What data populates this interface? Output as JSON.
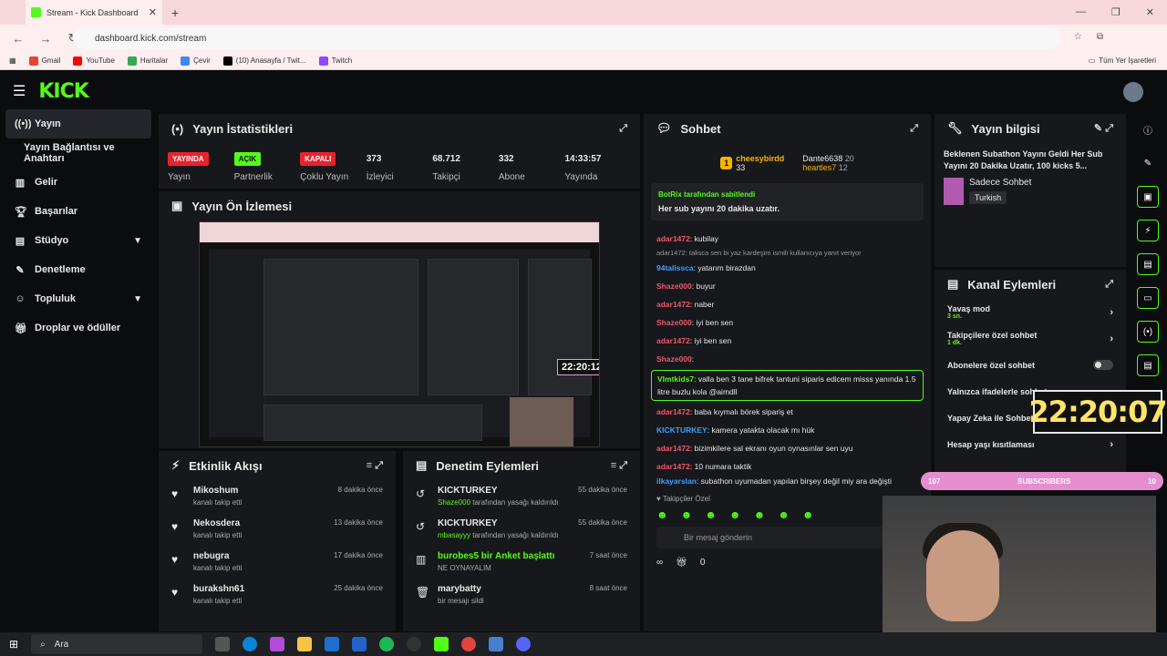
{
  "browser": {
    "tab_title": "Stream - Kick Dashboard",
    "url": "dashboard.kick.com/stream",
    "bookmarks": [
      "Gmail",
      "YouTube",
      "Haritalar",
      "Çevir",
      "(10) Anasayfa / Twit...",
      "Twitch"
    ],
    "bookmarks_right": "Tüm Yer İşaretleri"
  },
  "header": {
    "logo": "KICK"
  },
  "sidebar": {
    "items": [
      {
        "label": "Yayın"
      },
      {
        "label": "Yayın Bağlantısı ve Anahtarı"
      },
      {
        "label": "Gelir"
      },
      {
        "label": "Başarılar"
      },
      {
        "label": "Stüdyo"
      },
      {
        "label": "Denetleme"
      },
      {
        "label": "Topluluk"
      },
      {
        "label": "Droplar ve ödüller"
      }
    ]
  },
  "stats": {
    "title": "Yayın İstatistikleri",
    "items": [
      {
        "value": "YAYINDA",
        "label": "Yayın",
        "color": "#e8232e"
      },
      {
        "value": "AÇIK",
        "label": "Partnerlik",
        "color": "#53fc18"
      },
      {
        "value": "KAPALI",
        "label": "Çoklu Yayın",
        "color": "#e8232e"
      },
      {
        "value": "373",
        "label": "İzleyici"
      },
      {
        "value": "68.712",
        "label": "Takipçi"
      },
      {
        "value": "332",
        "label": "Abone"
      },
      {
        "value": "14:33:57",
        "label": "Yayında"
      }
    ]
  },
  "preview": {
    "title": "Yayın Ön İzlemesi",
    "timer": "22:20:12"
  },
  "activity": {
    "title": "Etkinlik Akışı",
    "items": [
      {
        "name": "Mikoshum",
        "sub": "kanalı takip etti",
        "time": "8 dakika önce"
      },
      {
        "name": "Nekosdera",
        "sub": "kanalı takip etti",
        "time": "13 dakika önce"
      },
      {
        "name": "nebugra",
        "sub": "kanalı takip etti",
        "time": "17 dakika önce"
      },
      {
        "name": "burakshn61",
        "sub": "kanalı takip etti",
        "time": "25 dakika önce"
      }
    ]
  },
  "moderation": {
    "title": "Denetim Eylemleri",
    "items": [
      {
        "name": "KICKTURKEY",
        "who": "Shaze000",
        "sub": " tarafından yasağı kaldırıldı",
        "time": "55 dakika önce"
      },
      {
        "name": "KICKTURKEY",
        "who": "mbasayyy",
        "sub": " tarafından yasağı kaldırıldı",
        "time": "55 dakika önce"
      },
      {
        "name": "burobes5 bir Anket başlattı",
        "who": "",
        "sub": "NE OYNAYALIM",
        "time": "7 saat önce"
      },
      {
        "name": "marybatty",
        "who": "",
        "sub": "bir mesajı sildi",
        "time": "8 saat önce"
      }
    ]
  },
  "chat": {
    "title": "Sohbet",
    "top": [
      {
        "name": "cheesybirdd",
        "count": "33"
      },
      {
        "name": "Dante6638",
        "count": "20"
      },
      {
        "name": "heartles7",
        "count": "12"
      }
    ],
    "pinned_by": "BotRix tarafından sabitlendi",
    "pinned_text": "Her sub yayını 20 dakika uzatır.",
    "messages": [
      {
        "user": "adar1472",
        "text": ": kubilay"
      },
      {
        "user": "94talissca",
        "text": ": yatarım birazdan",
        "reply": "adar1472: talisca sen bi yaz kardeşim ismili kullanıcıya yanıt veriyor"
      },
      {
        "user": "Shaze000",
        "text": ": buyur"
      },
      {
        "user": "adar1472",
        "text": ": naber"
      },
      {
        "user": "Shaze000",
        "text": ": iyi ben sen"
      },
      {
        "user": "adar1472",
        "text": ": iyi ben sen"
      },
      {
        "user": "Shaze000",
        "text": ":"
      }
    ],
    "highlight": {
      "user": "Vlmtkids7",
      "text": ": valla ben 3 tane bifrek tantuni siparis edicem misss yanında 1.5 litre buzlu kola @aimdll"
    },
    "messages2": [
      {
        "user": "adar1472",
        "text": ": baba kıymalı börek sipariş et"
      },
      {
        "user": "KICKTURKEY",
        "text": ": kamera yatakta olacak mı hük"
      },
      {
        "user": "adar1472",
        "text": ": bizimkilere sal ekranı oyun oynasınlar sen uyu"
      },
      {
        "user": "adar1472",
        "text": ": 10 numara taktik"
      },
      {
        "user": "ilkayarslan",
        "text": ": subathon uyumadan yapılan birşey değil miy ara değişti"
      }
    ],
    "follower_only": "Takipçiler Özel",
    "placeholder": "Bir mesaj gönderin",
    "footer_count": "0"
  },
  "info": {
    "title": "Yayın bilgisi",
    "stream_title": "Beklenen Subathon Yayını Geldi Her Sub Yayını 20 Dakika Uzatır, 100 kicks 5...",
    "category": "Sadece Sohbet",
    "tag": "Turkish"
  },
  "actions": {
    "title": "Kanal Eylemleri",
    "items": [
      {
        "label": "Yavaş mod",
        "sub": "3 sn."
      },
      {
        "label": "Takipçilere özel sohbet",
        "sub": "1 dk."
      },
      {
        "label": "Abonelere özel sohbet",
        "sub": ""
      },
      {
        "label": "Yalnızca ifadelerle sohbet",
        "sub": ""
      },
      {
        "label": "Yapay Zeka ile Sohbet",
        "sub": ""
      },
      {
        "label": "Hesap yaşı kısıtlaması",
        "sub": ""
      }
    ]
  },
  "overlay": {
    "timer": "22:20:07",
    "subs_left": "107",
    "subs_label": "SUBSCRIBERS",
    "subs_right": "10"
  },
  "taskbar": {
    "search": "Ara"
  }
}
